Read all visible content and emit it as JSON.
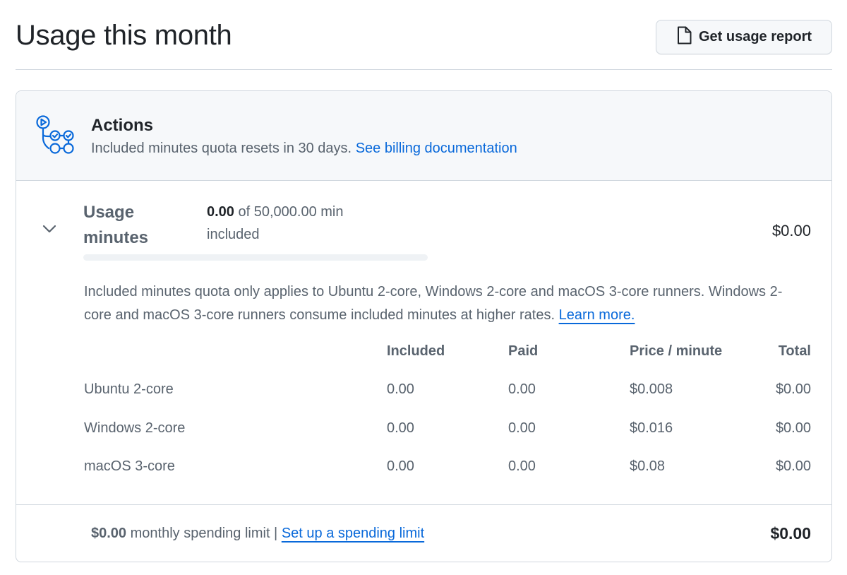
{
  "page": {
    "title": "Usage this month",
    "report_button": "Get usage report"
  },
  "actions": {
    "title": "Actions",
    "subtitle": "Included minutes quota resets in 30 days.",
    "doc_link": "See billing documentation",
    "usage_label": "Usage minutes",
    "used": "0.00",
    "of_text": "of 50,000.00 min included",
    "usage_total": "$0.00",
    "progress_fraction": 0,
    "note": "Included minutes quota only applies to Ubuntu 2-core, Windows 2-core and macOS 3-core runners. Windows 2-core and macOS 3-core runners consume included minutes at higher rates.",
    "learn_more": "Learn more."
  },
  "table": {
    "headers": [
      "Included",
      "Paid",
      "Price / minute",
      "Total"
    ],
    "rows": [
      {
        "name": "Ubuntu 2-core",
        "included": "0.00",
        "paid": "0.00",
        "price": "$0.008",
        "total": "$0.00"
      },
      {
        "name": "Windows 2-core",
        "included": "0.00",
        "paid": "0.00",
        "price": "$0.016",
        "total": "$0.00"
      },
      {
        "name": "macOS 3-core",
        "included": "0.00",
        "paid": "0.00",
        "price": "$0.08",
        "total": "$0.00"
      }
    ]
  },
  "footer": {
    "limit_amount": "$0.00",
    "limit_text": "monthly spending limit |",
    "limit_link": "Set up a spending limit",
    "total": "$0.00"
  },
  "icons": {
    "report": "file-icon",
    "actions": "workflow-icon",
    "expand": "chevron-down-icon"
  },
  "colors": {
    "accent": "#0969da",
    "muted_text": "#59636e",
    "header_bg": "#f6f8fa",
    "border": "#d0d7de"
  }
}
